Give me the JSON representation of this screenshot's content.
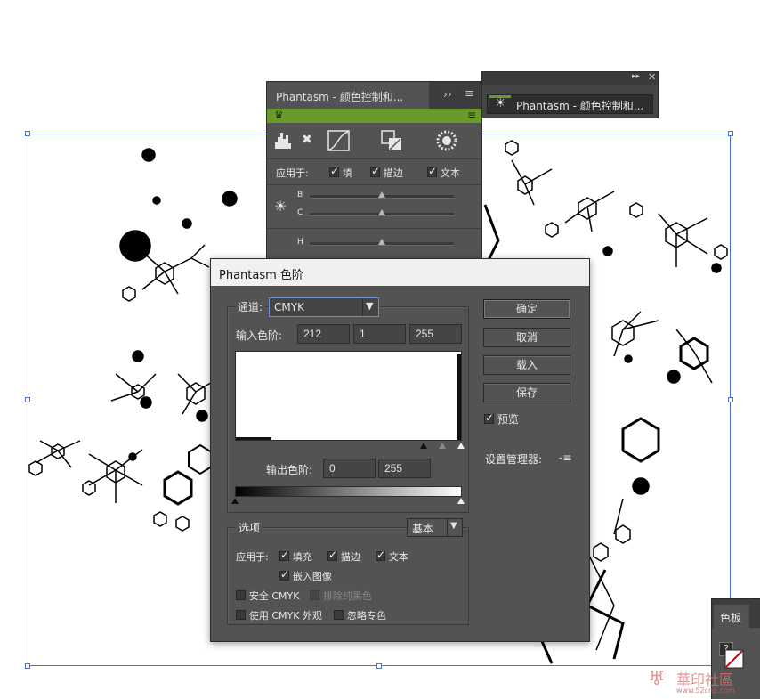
{
  "colors": {
    "accent_green": "#6a9a2a",
    "panel_bg": "#535353",
    "selection_blue": "#4a6fd8"
  },
  "back_panel": {
    "tab_title": "Phantasm - 颜色控制和...",
    "apply_to_label": "应用于:",
    "apply_items": [
      "填",
      "描边",
      "文本"
    ],
    "slider_labels": [
      "B",
      "C",
      "H"
    ]
  },
  "float_panel": {
    "title": "Phantasm - 颜色控制和..."
  },
  "dialog": {
    "title": "Phantasm 色阶",
    "channel_label": "通道:",
    "channel_value": "CMYK",
    "input_levels_label": "输入色阶:",
    "input_levels": [
      "212",
      "1",
      "255"
    ],
    "output_levels_label": "输出色阶:",
    "output_levels": [
      "0",
      "255"
    ],
    "buttons": {
      "ok": "确定",
      "cancel": "取消",
      "load": "载入",
      "save": "保存"
    },
    "preview_label": "预览",
    "preset_manager_label": "设置管理器:",
    "options_label": "选项",
    "options_mode": "基本",
    "apply_to_label": "应用于:",
    "apply_fill": "填充",
    "apply_stroke": "描边",
    "apply_text": "文本",
    "embed_images": "嵌入图像",
    "safe_cmyk": "安全 CMYK",
    "exclude_black": "排除纯黑色",
    "use_cmyk_view": "使用 CMYK 外观",
    "ignore_spot": "忽略专色"
  },
  "swatch_panel": {
    "title": "色板",
    "help_glyph": "?"
  },
  "watermark": {
    "text": "華印社區",
    "url": "www.52cnp.com"
  }
}
